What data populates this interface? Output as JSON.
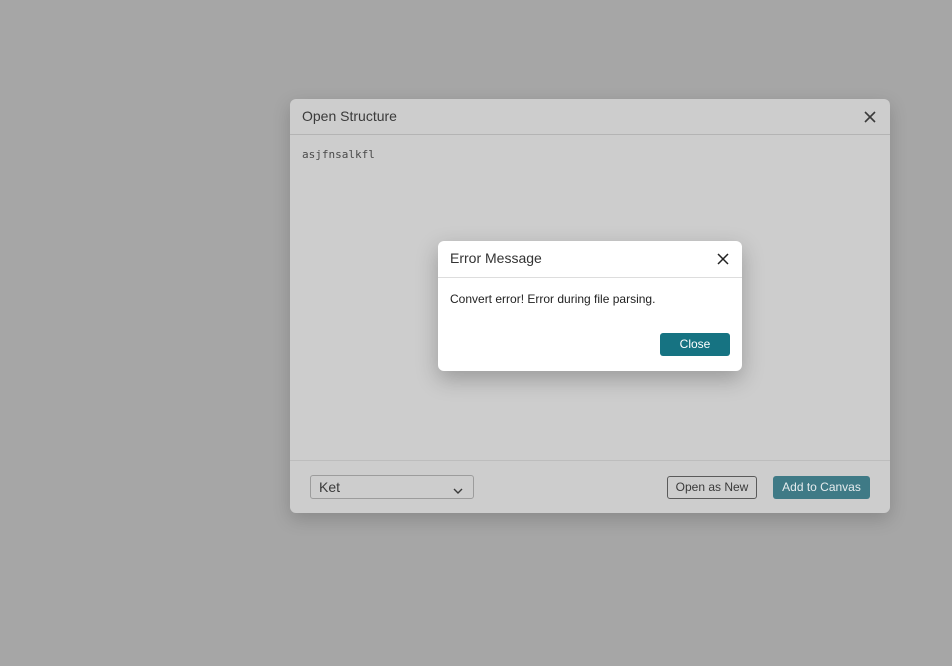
{
  "open_structure": {
    "title": "Open Structure",
    "textarea_value": "asjfnsalkfl",
    "format_select": {
      "selected": "Ket"
    },
    "buttons": {
      "open_as_new": "Open as New",
      "add_to_canvas": "Add to Canvas"
    },
    "colors": {
      "accent_dimmed": "#3f7a86"
    }
  },
  "error_dialog": {
    "title": "Error Message",
    "message": "Convert error! Error during file parsing.",
    "close_button": "Close",
    "colors": {
      "accent": "#167382"
    }
  },
  "icons": {
    "open_close": "close-icon",
    "error_close": "close-icon",
    "select_chevron": "chevron-down-icon"
  }
}
